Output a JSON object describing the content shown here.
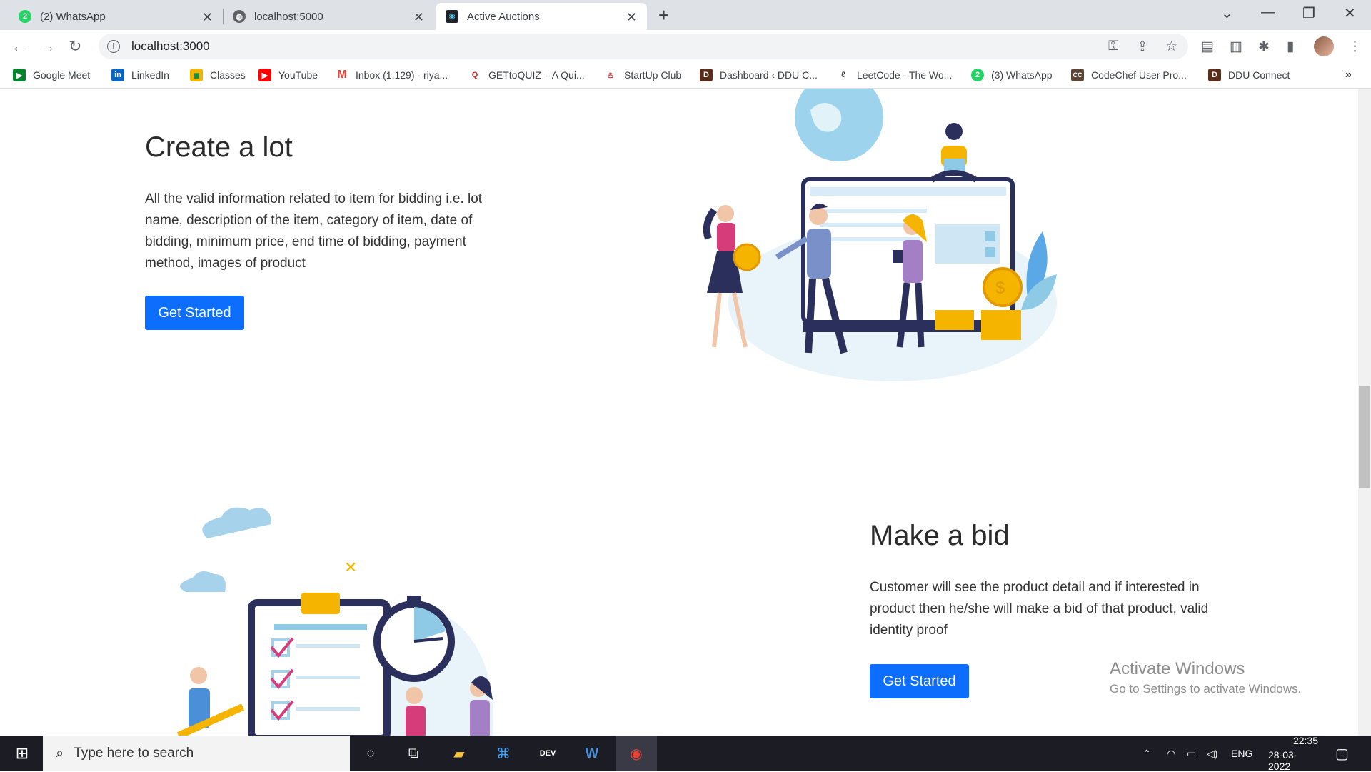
{
  "browser": {
    "tabs": [
      {
        "label": "(2) WhatsApp",
        "icon": "whatsapp-icon"
      },
      {
        "label": "localhost:5000",
        "icon": "globe-icon"
      },
      {
        "label": "Active Auctions",
        "icon": "react-icon"
      }
    ],
    "url": "localhost:3000",
    "bookmarks": [
      {
        "label": "Google Meet"
      },
      {
        "label": "LinkedIn"
      },
      {
        "label": "Classes"
      },
      {
        "label": "YouTube"
      },
      {
        "label": "Inbox (1,129) - riya..."
      },
      {
        "label": "GETtoQUIZ – A Qui..."
      },
      {
        "label": "StartUp Club"
      },
      {
        "label": "Dashboard ‹ DDU C..."
      },
      {
        "label": "LeetCode - The Wo..."
      },
      {
        "label": "(3) WhatsApp"
      },
      {
        "label": "CodeChef User Pro..."
      },
      {
        "label": "DDU Connect"
      }
    ]
  },
  "sections": [
    {
      "title": "Create a lot",
      "description": "All the valid information related to item for bidding i.e. lot name, description of the item, category of item, date of bidding, minimum price, end time of bidding, payment method, images of product",
      "button": "Get Started"
    },
    {
      "title": "Make a bid",
      "description": "Customer will see the product detail and if interested in product then he/she will make a bid of that product, valid identity proof",
      "button": "Get Started"
    }
  ],
  "watermark": {
    "title": "Activate Windows",
    "subtitle": "Go to Settings to activate Windows."
  },
  "taskbar": {
    "search_placeholder": "Type here to search",
    "language": "ENG",
    "time": "22:35",
    "date": "28-03-2022"
  },
  "colors": {
    "primary_button": "#0d6efd",
    "illustration_navy": "#2a2f5b",
    "illustration_blue": "#8ecae6",
    "illustration_gold": "#f5b400",
    "illustration_pink": "#d63c7a"
  }
}
